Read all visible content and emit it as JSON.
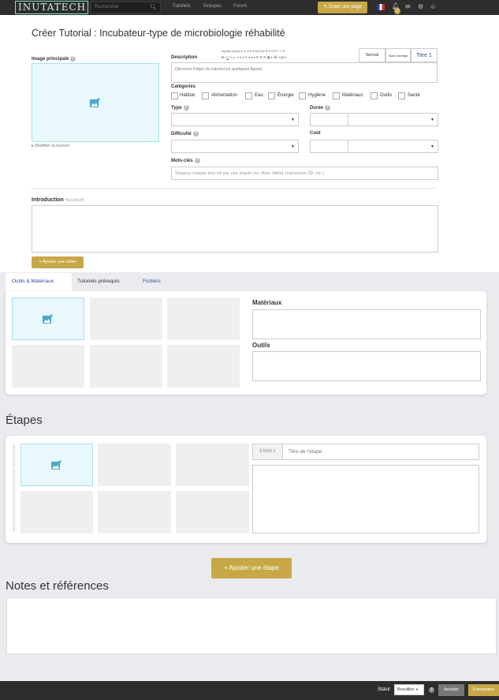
{
  "header": {
    "logo_text": "INUTATECH",
    "search_placeholder": "Rechercher",
    "nav": [
      "Tutoriels",
      "Groupes",
      "Forum"
    ],
    "create_page_label": "Créer une page",
    "notif_count": "1"
  },
  "page": {
    "title": "Créer Tutorial : Incubateur-type de microbiologie réhabilité"
  },
  "main_image": {
    "label": "Image principale",
    "license_link": "Modifier la licence"
  },
  "description": {
    "label": "Description",
    "placeholder": "Décrivez l'objet du tutoriel en quelques lignes.",
    "toolbar_font": "Ayuda (local)",
    "toolbar_size": "11",
    "style_options": [
      "Normal",
      "Sans interlign",
      "Titre 1"
    ]
  },
  "categories": {
    "label": "Catégories",
    "items": [
      "Habitat",
      "Alimentation",
      "Eau",
      "Énergie",
      "Hygiène",
      "Matériaux",
      "Outils",
      "Santé"
    ]
  },
  "fields": {
    "type_label": "Type",
    "duree_label": "Durée",
    "difficulte_label": "Difficulté",
    "cout_label": "Coût",
    "motscles_label": "Mots-clés",
    "motscles_placeholder": "Séparez chaque mot-clé par une virgule (ex: Bois, Métal, Impression 3D, etc.)"
  },
  "introduction": {
    "label": "Introduction",
    "optional": "(facultatif)",
    "add_video_label": "+ Ajouter une vidéo"
  },
  "tabs": {
    "items": [
      "Outils & Matériaux",
      "Tutoriels prérequis",
      "Fichiers"
    ],
    "active": 0,
    "materiaux_label": "Matériaux",
    "outils_label": "Outils"
  },
  "etapes": {
    "title": "Étapes",
    "step_prefix": "ÉTAPE 1",
    "step_title_placeholder": "Titre de l'étape",
    "add_step_label": "+ Ajouter une étape"
  },
  "notes": {
    "title": "Notes et références"
  },
  "footer": {
    "statut_label": "Statut",
    "statut_value": "Brouillon",
    "cancel_label": "Annuler",
    "save_label": "Enregistrer"
  },
  "colors": {
    "gold": "#c8a846",
    "link_blue": "#2c4c9c",
    "dark_bar": "#2d2d2d",
    "dropzone_bg": "#e9f8fc"
  }
}
